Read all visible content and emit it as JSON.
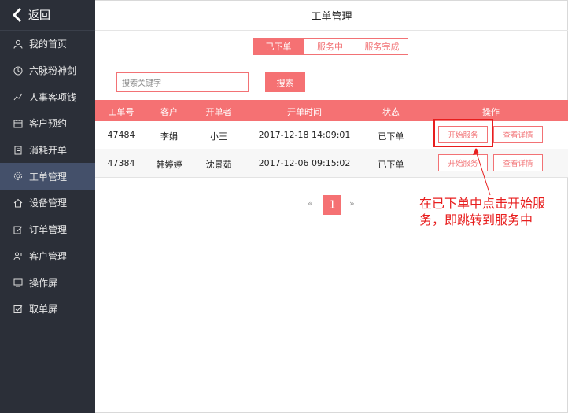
{
  "sidebar": {
    "back_label": "返回",
    "items": [
      {
        "label": "我的首页",
        "icon": "user-icon"
      },
      {
        "label": "六脉粉神剑",
        "icon": "clock-icon"
      },
      {
        "label": "人事客项钱",
        "icon": "chart-icon"
      },
      {
        "label": "客户预约",
        "icon": "calendar-icon"
      },
      {
        "label": "消耗开单",
        "icon": "document-icon"
      },
      {
        "label": "工单管理",
        "icon": "gear-icon",
        "active": true
      },
      {
        "label": "设备管理",
        "icon": "home-icon"
      },
      {
        "label": "订单管理",
        "icon": "edit-icon"
      },
      {
        "label": "客户管理",
        "icon": "users-icon"
      },
      {
        "label": "操作屏",
        "icon": "monitor-icon"
      },
      {
        "label": "取单屏",
        "icon": "checkbox-icon"
      }
    ]
  },
  "header": {
    "title": "工单管理"
  },
  "tabs": [
    {
      "label": "已下单",
      "active": true
    },
    {
      "label": "服务中"
    },
    {
      "label": "服务完成"
    }
  ],
  "search": {
    "placeholder": "搜索关键字",
    "button_label": "搜索"
  },
  "table": {
    "columns": [
      "工单号",
      "客户",
      "开单者",
      "开单时间",
      "状态",
      "操作"
    ],
    "rows": [
      {
        "id": "47484",
        "customer": "李娟",
        "opener": "小王",
        "time": "2017-12-18 14:09:01",
        "status": "已下单",
        "action1": "开始服务",
        "action2": "查看详情"
      },
      {
        "id": "47384",
        "customer": "韩婷婷",
        "opener": "沈景茹",
        "time": "2017-12-06 09:15:02",
        "status": "已下单",
        "action1": "开始服务",
        "action2": "查看详情"
      }
    ]
  },
  "pagination": {
    "prev": "«",
    "current": "1",
    "next": "»"
  },
  "annotation": {
    "text": "在已下单中点击开始服务，即跳转到服务中"
  },
  "colors": {
    "accent": "#f57173",
    "sidebar_bg": "#2b2f38",
    "annotation": "#e81e1e"
  }
}
